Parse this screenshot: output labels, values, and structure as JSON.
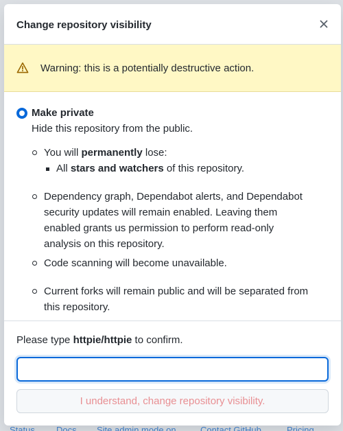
{
  "background": {
    "footer_links": [
      "Status",
      "Docs",
      "Site admin mode on",
      "Contact GitHub",
      "Pricing"
    ]
  },
  "dialog": {
    "title": "Change repository visibility",
    "close_icon": "close-icon",
    "warning": {
      "icon": "alert-triangle-icon",
      "text": "Warning: this is a potentially destructive action."
    },
    "option": {
      "label": "Make private",
      "description": "Hide this repository from the public.",
      "selected": true
    },
    "consequences": {
      "lose_prefix": "You will ",
      "lose_bold": "permanently",
      "lose_suffix": " lose:",
      "sub_prefix": "All ",
      "sub_bold": "stars and watchers",
      "sub_suffix": " of this repository.",
      "dependency": [
        "Dependency graph, Dependabot alerts, and Dependabot",
        "security updates will remain enabled. Leaving them",
        "enabled grants us permission to perform read-only",
        "analysis on this repository."
      ],
      "code_scanning": "Code scanning will become unavailable.",
      "forks": [
        "Current forks will remain public and will be separated from",
        "this repository."
      ]
    },
    "confirm": {
      "prefix": "Please type ",
      "repo": "httpie/httpie",
      "suffix": " to confirm.",
      "input_value": "",
      "input_placeholder": "",
      "button_label": "I understand, change repository visibility."
    }
  },
  "colors": {
    "accent": "#0969da",
    "warning_bg": "#fff8c5",
    "danger_text_disabled": "#e88f93"
  }
}
